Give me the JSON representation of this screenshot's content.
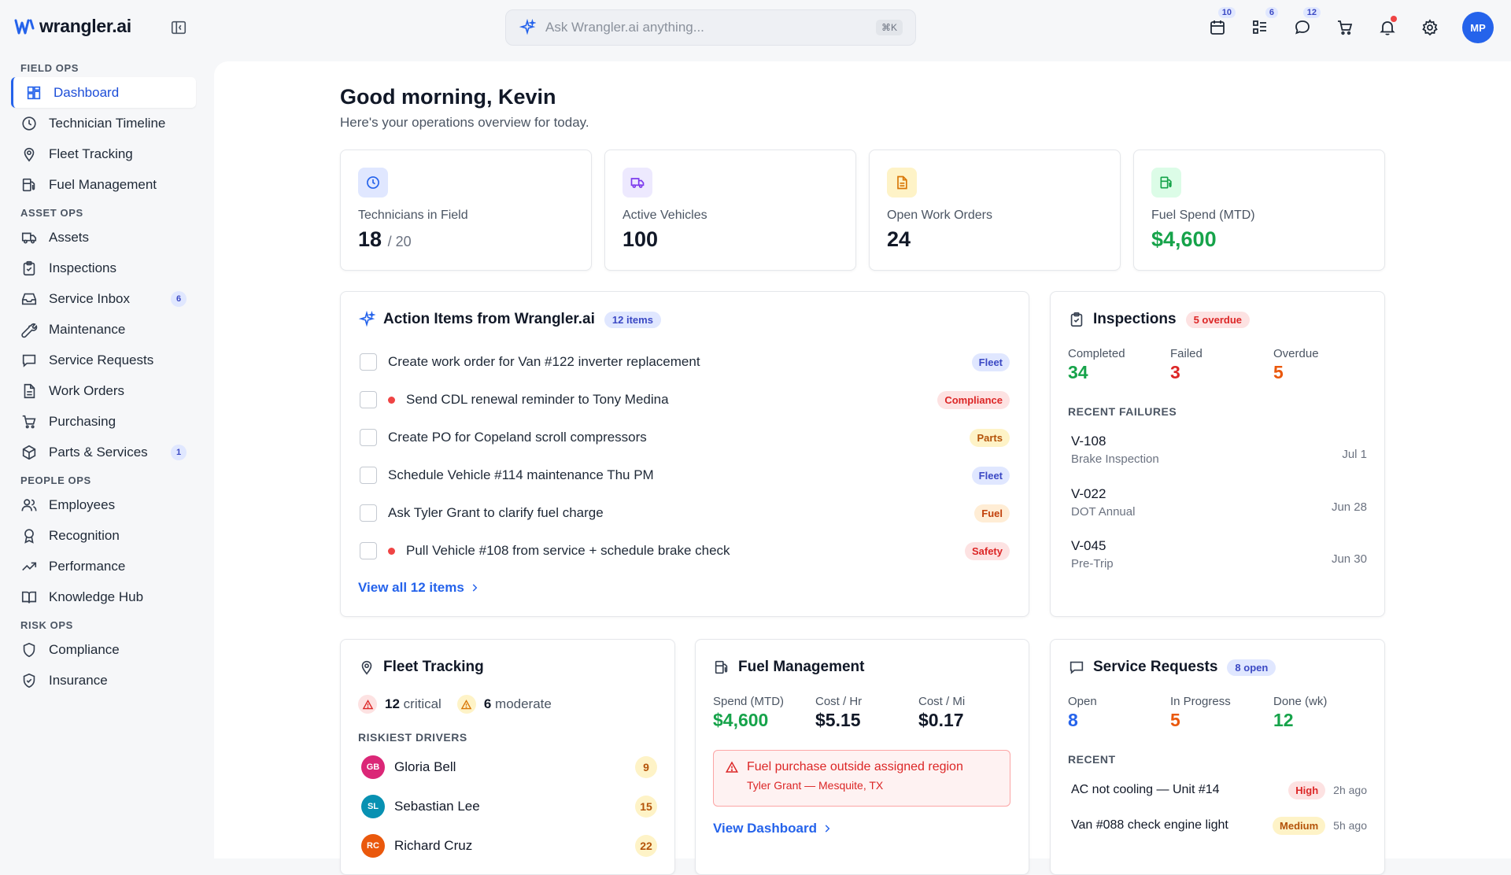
{
  "brand": {
    "name": "wrangler.ai"
  },
  "search": {
    "placeholder": "Ask Wrangler.ai anything...",
    "shortcut": "⌘K"
  },
  "top_icons": {
    "calendar_badge": "10",
    "tasks_badge": "6",
    "messages_badge": "12",
    "avatar_initials": "MP"
  },
  "sidebar": {
    "sections": {
      "field_ops": "FIELD OPS",
      "asset_ops": "ASSET OPS",
      "people_ops": "PEOPLE OPS",
      "risk_ops": "RISK OPS"
    },
    "items": [
      {
        "label": "Dashboard",
        "icon": "dashboard-icon"
      },
      {
        "label": "Technician Timeline",
        "icon": "clock-icon"
      },
      {
        "label": "Fleet Tracking",
        "icon": "map-pin-icon"
      },
      {
        "label": "Fuel Management",
        "icon": "fuel-icon"
      },
      {
        "label": "Assets",
        "icon": "truck-icon"
      },
      {
        "label": "Inspections",
        "icon": "clipboard-icon"
      },
      {
        "label": "Service Inbox",
        "icon": "inbox-icon",
        "badge": "6"
      },
      {
        "label": "Maintenance",
        "icon": "wrench-icon"
      },
      {
        "label": "Service Requests",
        "icon": "message-icon"
      },
      {
        "label": "Work Orders",
        "icon": "document-icon"
      },
      {
        "label": "Purchasing",
        "icon": "cart-icon"
      },
      {
        "label": "Parts & Services",
        "icon": "package-icon",
        "badge": "1"
      },
      {
        "label": "Employees",
        "icon": "users-icon"
      },
      {
        "label": "Recognition",
        "icon": "award-icon"
      },
      {
        "label": "Performance",
        "icon": "trending-icon"
      },
      {
        "label": "Knowledge Hub",
        "icon": "book-icon"
      },
      {
        "label": "Compliance",
        "icon": "shield-icon"
      },
      {
        "label": "Insurance",
        "icon": "shield-check-icon"
      }
    ]
  },
  "header": {
    "greeting": "Good morning, Kevin",
    "subtitle": "Here's your operations overview for today."
  },
  "stats": [
    {
      "label": "Technicians in Field",
      "value": "18",
      "sub": "/ 20",
      "icon": "clock-icon",
      "color": "#2563eb"
    },
    {
      "label": "Active Vehicles",
      "value": "100",
      "icon": "truck-icon",
      "color": "#7c3aed"
    },
    {
      "label": "Open Work Orders",
      "value": "24",
      "icon": "document-icon",
      "color": "#d97706"
    },
    {
      "label": "Fuel Spend (MTD)",
      "value": "$4,600",
      "icon": "fuel-icon",
      "color": "#16a34a"
    }
  ],
  "action_items": {
    "title": "Action Items from Wrangler.ai",
    "count_label": "12 items",
    "items": [
      {
        "text": "Create work order for Van #122 inverter replacement",
        "tag": "Fleet",
        "urgent": false
      },
      {
        "text": "Send CDL renewal reminder to Tony Medina",
        "tag": "Compliance",
        "urgent": true
      },
      {
        "text": "Create PO for Copeland scroll compressors",
        "tag": "Parts",
        "urgent": false
      },
      {
        "text": "Schedule Vehicle #114 maintenance Thu PM",
        "tag": "Fleet",
        "urgent": false
      },
      {
        "text": "Ask Tyler Grant to clarify fuel charge",
        "tag": "Fuel",
        "urgent": false
      },
      {
        "text": "Pull Vehicle #108 from service + schedule brake check",
        "tag": "Safety",
        "urgent": true
      }
    ],
    "view_all": "View all 12 items"
  },
  "inspections": {
    "title": "Inspections",
    "overdue_pill": "5 overdue",
    "completed_label": "Completed",
    "completed": "34",
    "failed_label": "Failed",
    "failed": "3",
    "overdue_label": "Overdue",
    "overdue": "5",
    "recent_label": "RECENT FAILURES",
    "failures": [
      {
        "id": "V-108",
        "type": "Brake Inspection",
        "date": "Jul 1"
      },
      {
        "id": "V-022",
        "type": "DOT Annual",
        "date": "Jun 28"
      },
      {
        "id": "V-045",
        "type": "Pre-Trip",
        "date": "Jun 30"
      }
    ]
  },
  "fleet": {
    "title": "Fleet Tracking",
    "critical_count": "12",
    "critical_label": "critical",
    "moderate_count": "6",
    "moderate_label": "moderate",
    "riskiest_label": "RISKIEST DRIVERS",
    "drivers": [
      {
        "initials": "GB",
        "name": "Gloria Bell",
        "score": "9",
        "color": "#db2777"
      },
      {
        "initials": "SL",
        "name": "Sebastian Lee",
        "score": "15",
        "color": "#0891b2"
      },
      {
        "initials": "RC",
        "name": "Richard Cruz",
        "score": "22",
        "color": "#ea580c"
      }
    ]
  },
  "fuel": {
    "title": "Fuel Management",
    "spend_label": "Spend (MTD)",
    "spend": "$4,600",
    "cost_hr_label": "Cost / Hr",
    "cost_hr": "$5.15",
    "cost_mi_label": "Cost / Mi",
    "cost_mi": "$0.17",
    "alert_title": "Fuel purchase outside assigned region",
    "alert_sub": "Tyler Grant — Mesquite, TX",
    "view_dashboard": "View Dashboard"
  },
  "service_requests": {
    "title": "Service Requests",
    "open_pill": "8 open",
    "open_label": "Open",
    "open": "8",
    "progress_label": "In Progress",
    "progress": "5",
    "done_label": "Done (wk)",
    "done": "12",
    "recent_label": "RECENT",
    "items": [
      {
        "text": "AC not cooling — Unit #14",
        "priority": "High",
        "time": "2h ago"
      },
      {
        "text": "Van #088 check engine light",
        "priority": "Medium",
        "time": "5h ago"
      }
    ]
  }
}
